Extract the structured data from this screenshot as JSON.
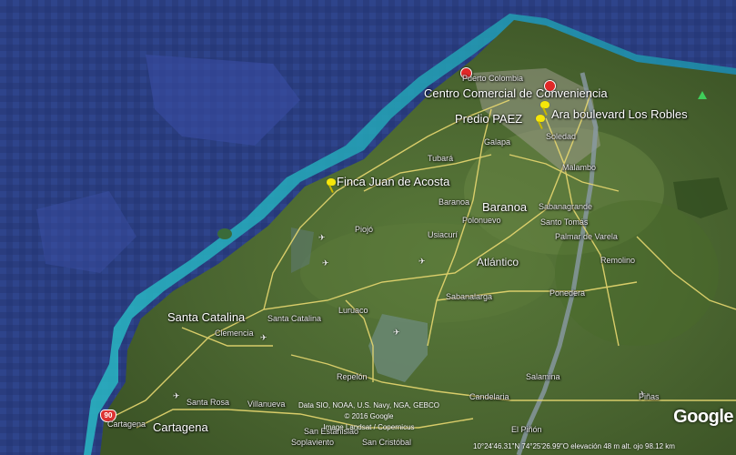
{
  "map": {
    "places": {
      "puerto_colombia": "Puerto Colombia",
      "centro_comercial": "Centro Comercial de Conveniencia",
      "ara_los_robles": "Ara boulevard Los Robles",
      "predio_paez": "Predio PAEZ",
      "soledad": "Soledad",
      "galapa": "Galapa",
      "tubara": "Tubará",
      "malambo": "Malambo",
      "finca_juan": "Finca Juan de Acosta",
      "baranoa_small": "Baranoa",
      "baranoa": "Baranoa",
      "sabanagrande": "Sabanagrande",
      "polonuevo": "Polonuevo",
      "santo_tomas": "Santo Tomás",
      "palmar": "Palmar de Varela",
      "piojo": "Piojó",
      "usiacuri": "Usiacurí",
      "atlantico": "Atlántico",
      "remolino": "Remolino",
      "ponedera": "Ponedera",
      "sabanalarga": "Sabanalarga",
      "santa_catalina_big": "Santa Catalina",
      "santa_catalina_small": "Santa Catalina",
      "clemencia": "Clemencia",
      "luruaco": "Luruaco",
      "repelon": "Repelón",
      "salamina": "Salamina",
      "pinas": "Piñas",
      "santa_rosa": "Santa Rosa",
      "villanueva": "Villanueva",
      "candelaria": "Candelaria",
      "cartagena": "Cartagena",
      "cartagena_small": "Cartagena",
      "el_pinon": "El Piñón",
      "san_estanislao": "San Estanislao",
      "soplaviento": "Soplaviento",
      "san_cristobal": "San Cristóbal"
    },
    "road_shield": "90",
    "attribution": {
      "line1": "Data SIO, NOAA, U.S. Navy, NGA, GEBCO",
      "line2": "© 2016 Google",
      "line3": "Image Landsat / Copernicus"
    },
    "status": "10°24'46.31\"N  74°25'26.99\"O  elevación  48 m    alt. ojo 98.12 km",
    "logo": "Google",
    "colors": {
      "sea": "#2b3f82",
      "sea_light": "#3d58a8",
      "land": "#4e6a34",
      "land_dark": "#3f5a28",
      "coast": "#2cc0c8",
      "road": "#e8d870",
      "pin": "#f5e60a",
      "poi": "#e02828"
    }
  }
}
